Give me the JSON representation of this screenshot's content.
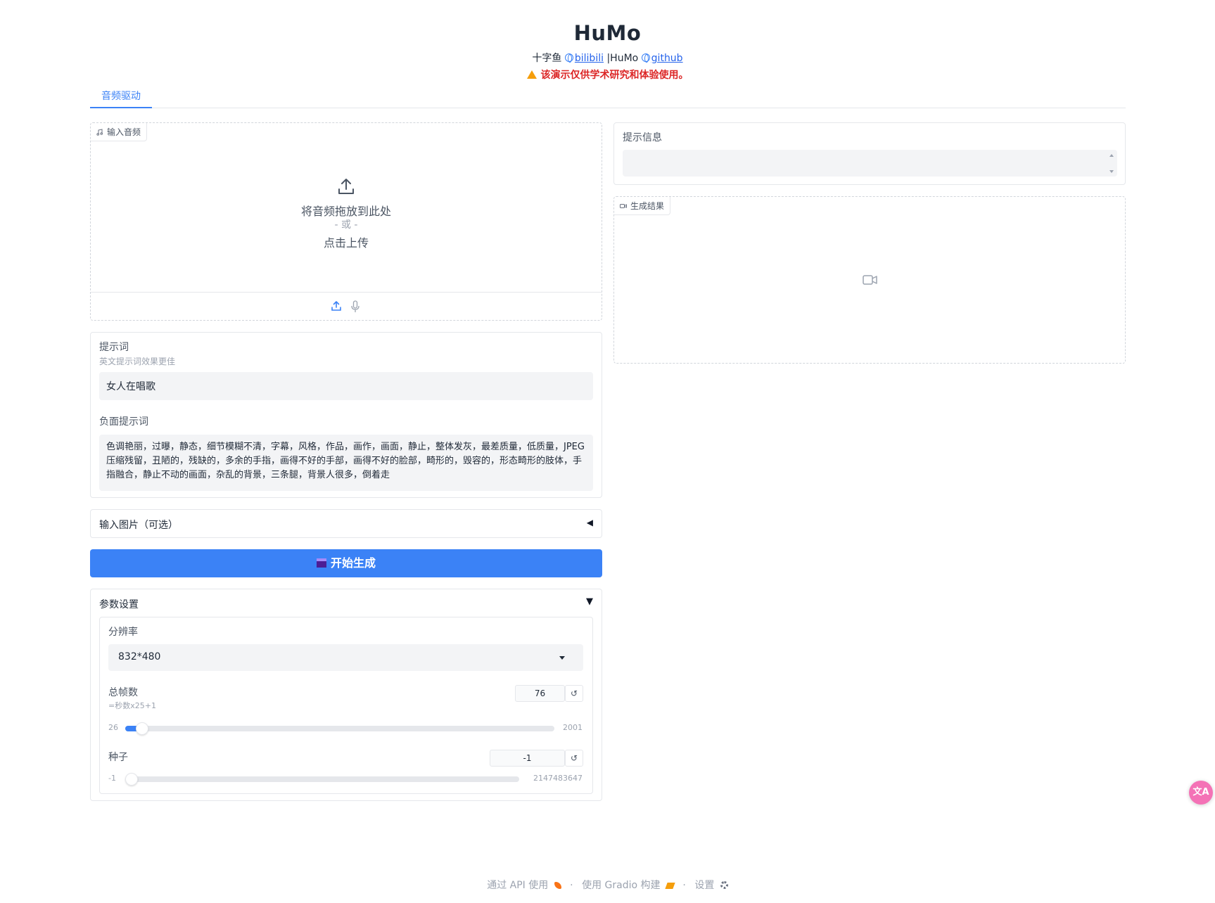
{
  "header": {
    "title": "HuMo",
    "author": "十字鱼",
    "link1": "bilibili",
    "separator": "|HuMo",
    "link2": "github",
    "warning": "该演示仅供学术研究和体验使用。"
  },
  "tabs": [
    {
      "label": "音频驱动",
      "active": true
    }
  ],
  "audio_input": {
    "label": "输入音频",
    "drop_text": "将音频拖放到此处",
    "or_text": "- 或 -",
    "click_text": "点击上传"
  },
  "prompt": {
    "label": "提示词",
    "hint": "英文提示词效果更佳",
    "value": "女人在唱歌"
  },
  "negative_prompt": {
    "label": "负面提示词",
    "value": "色调艳丽，过曝，静态，细节模糊不清，字幕，风格，作品，画作，画面，静止，整体发灰，最差质量，低质量，JPEG压缩残留，丑陋的，残缺的，多余的手指，画得不好的手部，画得不好的脸部，畸形的，毁容的，形态畸形的肢体，手指融合，静止不动的画面，杂乱的背景，三条腿，背景人很多，倒着走"
  },
  "image_input": {
    "label": "输入图片（可选）",
    "arrow": "◀"
  },
  "generate_button": {
    "label": "开始生成"
  },
  "params": {
    "label": "参数设置",
    "arrow": "▼",
    "resolution": {
      "label": "分辨率",
      "value": "832*480"
    },
    "frames": {
      "label": "总帧数",
      "hint": "=秒数x25+1",
      "value": "76",
      "min": "26",
      "max": "2001",
      "fraction": 0.025
    },
    "seed": {
      "label": "种子",
      "value": "-1",
      "min": "-1",
      "max": "2147483647",
      "fraction": 0.0
    }
  },
  "info": {
    "label": "提示信息",
    "value": ""
  },
  "result": {
    "label": "生成结果"
  },
  "footer": {
    "api": "通过 API 使用",
    "built": "使用 Gradio 构建",
    "settings": "设置",
    "dot": "·"
  },
  "float_button": {
    "label": "文A"
  },
  "colors": {
    "accent": "#3b82f6",
    "warning": "#dc2626",
    "border": "#e5e7eb",
    "field": "#f3f4f6"
  }
}
